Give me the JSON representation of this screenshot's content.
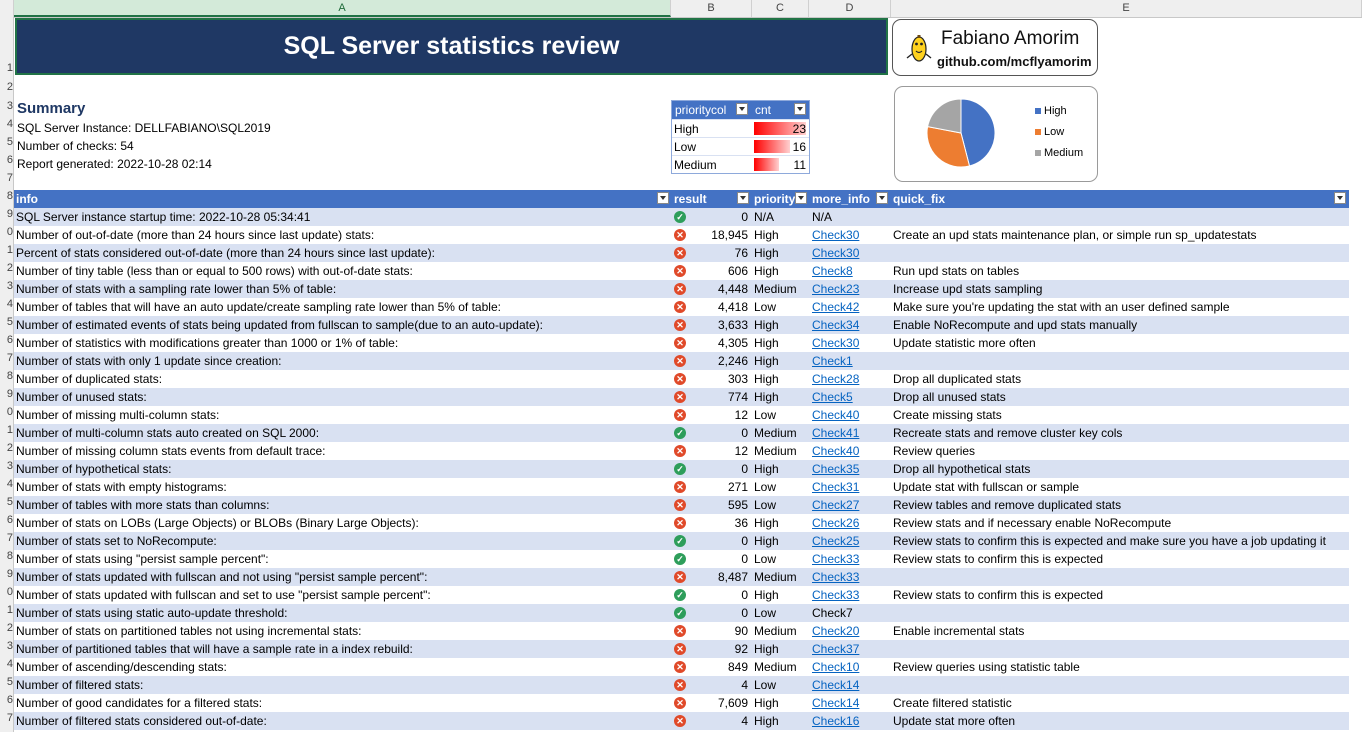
{
  "column_headers": [
    "A",
    "B",
    "C",
    "D",
    "E"
  ],
  "row_numbers": [
    "1",
    "2",
    "3",
    "4",
    "5",
    "6",
    "7",
    "8",
    "9",
    "0",
    "1",
    "2",
    "3",
    "4",
    "5",
    "6",
    "7",
    "8",
    "9",
    "0",
    "1",
    "2",
    "3",
    "4",
    "5",
    "6",
    "7",
    "8",
    "9",
    "0",
    "1",
    "2",
    "3",
    "4",
    "5",
    "6",
    "7"
  ],
  "title": "SQL Server statistics review",
  "author": {
    "name": "Fabiano Amorim",
    "link": "github.com/mcflyamorim"
  },
  "summary": {
    "heading": "Summary",
    "instance": "SQL Server Instance: DELLFABIANO\\SQL2019",
    "checks": "Number of checks: 54",
    "generated": "Report generated: 2022-10-28 02:14"
  },
  "pivot": {
    "col1": "prioritycol",
    "col2": "cnt",
    "rows": [
      {
        "label": "High",
        "cnt": "23",
        "frac": 1.0
      },
      {
        "label": "Low",
        "cnt": "16",
        "frac": 0.7
      },
      {
        "label": "Medium",
        "cnt": "11",
        "frac": 0.48
      }
    ]
  },
  "pie": {
    "legend": [
      "High",
      "Low",
      "Medium"
    ],
    "colors": [
      "#4472c4",
      "#ed7d31",
      "#a5a5a5"
    ],
    "values": [
      23,
      16,
      11
    ]
  },
  "table": {
    "headers": {
      "info": "info",
      "result": "result",
      "priority": "priority",
      "more_info": "more_info",
      "quick_fix": "quick_fix"
    },
    "rows": [
      {
        "info": "SQL Server instance startup time: 2022-10-28 05:34:41",
        "ok": true,
        "result": "0",
        "priority": "N/A",
        "more": "N/A",
        "link": false,
        "fix": ""
      },
      {
        "info": "Number of out-of-date (more than 24 hours since last update) stats:",
        "ok": false,
        "result": "18,945",
        "priority": "High",
        "more": "Check30",
        "link": true,
        "fix": "Create an upd stats maintenance plan, or simple run sp_updatestats"
      },
      {
        "info": "Percent of stats considered out-of-date (more than 24 hours since last update):",
        "ok": false,
        "result": "76",
        "priority": "High",
        "more": "Check30",
        "link": true,
        "fix": ""
      },
      {
        "info": "Number of tiny table (less than or equal to 500 rows) with out-of-date stats:",
        "ok": false,
        "result": "606",
        "priority": "High",
        "more": "Check8",
        "link": true,
        "fix": "Run upd stats on tables"
      },
      {
        "info": "Number of stats with a sampling rate lower than 5% of table:",
        "ok": false,
        "result": "4,448",
        "priority": "Medium",
        "more": "Check23",
        "link": true,
        "fix": "Increase upd stats sampling"
      },
      {
        "info": "Number of tables that will have an auto update/create sampling rate lower than 5% of table:",
        "ok": false,
        "result": "4,418",
        "priority": "Low",
        "more": "Check42",
        "link": true,
        "fix": "Make sure you're updating the stat with an user defined sample"
      },
      {
        "info": "Number of estimated events of stats being updated from fullscan to sample(due to an auto-update):",
        "ok": false,
        "result": "3,633",
        "priority": "High",
        "more": "Check34",
        "link": true,
        "fix": "Enable NoRecompute and upd stats manually"
      },
      {
        "info": "Number of statistics with modifications greater than 1000 or 1% of table:",
        "ok": false,
        "result": "4,305",
        "priority": "High",
        "more": "Check30",
        "link": true,
        "fix": "Update statistic more often"
      },
      {
        "info": "Number of stats with only 1 update since creation:",
        "ok": false,
        "result": "2,246",
        "priority": "High",
        "more": "Check1",
        "link": true,
        "fix": ""
      },
      {
        "info": "Number of duplicated stats:",
        "ok": false,
        "result": "303",
        "priority": "High",
        "more": "Check28",
        "link": true,
        "fix": "Drop all duplicated stats"
      },
      {
        "info": "Number of unused stats:",
        "ok": false,
        "result": "774",
        "priority": "High",
        "more": "Check5",
        "link": true,
        "fix": "Drop all unused stats"
      },
      {
        "info": "Number of missing multi-column stats:",
        "ok": false,
        "result": "12",
        "priority": "Low",
        "more": "Check40",
        "link": true,
        "fix": "Create missing stats"
      },
      {
        "info": "Number of multi-column stats auto created on SQL 2000:",
        "ok": true,
        "result": "0",
        "priority": "Medium",
        "more": "Check41",
        "link": true,
        "fix": "Recreate stats and remove cluster key cols"
      },
      {
        "info": "Number of missing column stats events from default trace:",
        "ok": false,
        "result": "12",
        "priority": "Medium",
        "more": "Check40",
        "link": true,
        "fix": "Review queries"
      },
      {
        "info": "Number of hypothetical stats:",
        "ok": true,
        "result": "0",
        "priority": "High",
        "more": "Check35",
        "link": true,
        "fix": "Drop all hypothetical stats"
      },
      {
        "info": "Number of stats with empty histograms:",
        "ok": false,
        "result": "271",
        "priority": "Low",
        "more": "Check31",
        "link": true,
        "fix": "Update stat with fullscan or sample"
      },
      {
        "info": "Number of tables with more stats than columns:",
        "ok": false,
        "result": "595",
        "priority": "Low",
        "more": "Check27",
        "link": true,
        "fix": "Review tables and remove duplicated stats"
      },
      {
        "info": "Number of stats on LOBs (Large Objects) or BLOBs (Binary Large Objects):",
        "ok": false,
        "result": "36",
        "priority": "High",
        "more": "Check26",
        "link": true,
        "fix": "Review stats and if necessary enable NoRecompute"
      },
      {
        "info": "Number of stats set to NoRecompute:",
        "ok": true,
        "result": "0",
        "priority": "High",
        "more": "Check25",
        "link": true,
        "fix": "Review stats to confirm this is expected and make sure you have a job updating it"
      },
      {
        "info": "Number of stats using \"persist sample percent\":",
        "ok": true,
        "result": "0",
        "priority": "Low",
        "more": "Check33",
        "link": true,
        "fix": "Review stats to confirm this is expected"
      },
      {
        "info": "Number of stats updated with fullscan and not using \"persist sample percent\":",
        "ok": false,
        "result": "8,487",
        "priority": "Medium",
        "more": "Check33",
        "link": true,
        "fix": ""
      },
      {
        "info": "Number of stats updated with fullscan and set to use \"persist sample percent\":",
        "ok": true,
        "result": "0",
        "priority": "High",
        "more": "Check33",
        "link": true,
        "fix": "Review stats to confirm this is expected"
      },
      {
        "info": "Number of stats using static auto-update threshold:",
        "ok": true,
        "result": "0",
        "priority": "Low",
        "more": "Check7",
        "link": false,
        "fix": ""
      },
      {
        "info": "Number of stats on partitioned tables not using incremental stats:",
        "ok": false,
        "result": "90",
        "priority": "Medium",
        "more": "Check20",
        "link": true,
        "fix": "Enable incremental stats"
      },
      {
        "info": "Number of partitioned tables that will have a sample rate in a index rebuild:",
        "ok": false,
        "result": "92",
        "priority": "High",
        "more": "Check37",
        "link": true,
        "fix": ""
      },
      {
        "info": "Number of ascending/descending stats:",
        "ok": false,
        "result": "849",
        "priority": "Medium",
        "more": "Check10",
        "link": true,
        "fix": "Review queries using statistic table"
      },
      {
        "info": "Number of filtered stats:",
        "ok": false,
        "result": "4",
        "priority": "Low",
        "more": "Check14",
        "link": true,
        "fix": ""
      },
      {
        "info": "Number of good candidates for a filtered stats:",
        "ok": false,
        "result": "7,609",
        "priority": "High",
        "more": "Check14",
        "link": true,
        "fix": "Create filtered statistic"
      },
      {
        "info": "Number of filtered stats considered out-of-date:",
        "ok": false,
        "result": "4",
        "priority": "High",
        "more": "Check16",
        "link": true,
        "fix": "Update stat more often"
      }
    ]
  }
}
